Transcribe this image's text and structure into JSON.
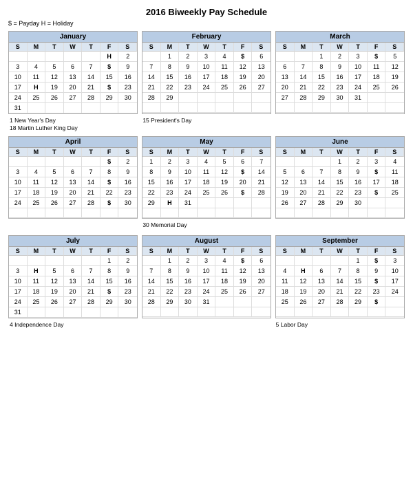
{
  "title": "2016 Biweekly Pay Schedule",
  "legend": "$ = Payday    H = Holiday",
  "months": [
    {
      "name": "January",
      "days": [
        "S",
        "M",
        "T",
        "W",
        "T",
        "F",
        "S"
      ],
      "cells": [
        "",
        "",
        "",
        "",
        "",
        "H",
        "2",
        "3",
        "4",
        "5",
        "6",
        "7",
        "$",
        "9",
        "10",
        "11",
        "12",
        "13",
        "14",
        "15",
        "16",
        "17",
        "H",
        "19",
        "20",
        "21",
        "$",
        "23",
        "24",
        "25",
        "26",
        "27",
        "28",
        "29",
        "30",
        "31",
        "",
        "",
        "",
        "",
        "",
        ""
      ],
      "notes": [
        "1 New Year's Day",
        "18 Martin Luther King Day"
      ]
    },
    {
      "name": "February",
      "days": [
        "S",
        "M",
        "T",
        "W",
        "T",
        "F",
        "S"
      ],
      "cells": [
        "",
        "1",
        "2",
        "3",
        "4",
        "$",
        "6",
        "7",
        "8",
        "9",
        "10",
        "11",
        "12",
        "13",
        "14",
        "15",
        "16",
        "17",
        "18",
        "19",
        "20",
        "21",
        "22",
        "23",
        "24",
        "25",
        "26",
        "27",
        "28",
        "29",
        "",
        "",
        "",
        "",
        "",
        "",
        "",
        "",
        "",
        "",
        "",
        ""
      ],
      "notes": [
        "15 President's Day"
      ]
    },
    {
      "name": "March",
      "days": [
        "S",
        "M",
        "T",
        "W",
        "T",
        "F",
        "S"
      ],
      "cells": [
        "",
        "",
        "1",
        "2",
        "3",
        "$",
        "5",
        "6",
        "7",
        "8",
        "9",
        "10",
        "11",
        "12",
        "13",
        "14",
        "15",
        "16",
        "17",
        "18",
        "19",
        "20",
        "21",
        "22",
        "23",
        "24",
        "25",
        "26",
        "27",
        "28",
        "29",
        "30",
        "31",
        "",
        "",
        "",
        "",
        "",
        "",
        "",
        "",
        ""
      ],
      "notes": []
    },
    {
      "name": "April",
      "days": [
        "S",
        "M",
        "T",
        "W",
        "T",
        "F",
        "S"
      ],
      "cells": [
        "",
        "",
        "",
        "",
        "",
        "$",
        "2",
        "3",
        "4",
        "5",
        "6",
        "7",
        "8",
        "9",
        "10",
        "11",
        "12",
        "13",
        "14",
        "$",
        "16",
        "17",
        "18",
        "19",
        "20",
        "21",
        "22",
        "23",
        "24",
        "25",
        "26",
        "27",
        "28",
        "$",
        "30",
        "",
        "",
        "",
        "",
        "",
        "",
        ""
      ],
      "notes": []
    },
    {
      "name": "May",
      "days": [
        "S",
        "M",
        "T",
        "W",
        "T",
        "F",
        "S"
      ],
      "cells": [
        "1",
        "2",
        "3",
        "4",
        "5",
        "6",
        "7",
        "8",
        "9",
        "10",
        "11",
        "12",
        "$",
        "14",
        "15",
        "16",
        "17",
        "18",
        "19",
        "20",
        "21",
        "22",
        "23",
        "24",
        "25",
        "26",
        "$",
        "28",
        "29",
        "H",
        "31",
        "",
        "",
        "",
        "",
        "",
        "",
        "",
        "",
        "",
        "",
        ""
      ],
      "notes": [
        "30 Memorial Day"
      ]
    },
    {
      "name": "June",
      "days": [
        "S",
        "M",
        "T",
        "W",
        "T",
        "F",
        "S"
      ],
      "cells": [
        "",
        "",
        "",
        "1",
        "2",
        "3",
        "4",
        "5",
        "6",
        "7",
        "8",
        "9",
        "$",
        "11",
        "12",
        "13",
        "14",
        "15",
        "16",
        "17",
        "18",
        "19",
        "20",
        "21",
        "22",
        "23",
        "$",
        "25",
        "26",
        "27",
        "28",
        "29",
        "30",
        "",
        "",
        "",
        "",
        "",
        "",
        "",
        "",
        ""
      ],
      "notes": []
    },
    {
      "name": "July",
      "days": [
        "S",
        "M",
        "T",
        "W",
        "T",
        "F",
        "S"
      ],
      "cells": [
        "",
        "",
        "",
        "",
        "",
        "1",
        "2",
        "3",
        "H",
        "5",
        "6",
        "7",
        "8",
        "9",
        "10",
        "11",
        "12",
        "13",
        "14",
        "15",
        "16",
        "17",
        "18",
        "19",
        "20",
        "21",
        "$",
        "23",
        "24",
        "25",
        "26",
        "27",
        "28",
        "29",
        "30",
        "31",
        "",
        "",
        "",
        "",
        "",
        ""
      ],
      "notes": [
        "4 Independence Day"
      ]
    },
    {
      "name": "August",
      "days": [
        "S",
        "M",
        "T",
        "W",
        "T",
        "F",
        "S"
      ],
      "cells": [
        "",
        "1",
        "2",
        "3",
        "4",
        "$",
        "6",
        "7",
        "8",
        "9",
        "10",
        "11",
        "12",
        "13",
        "14",
        "15",
        "16",
        "17",
        "18",
        "19",
        "20",
        "21",
        "22",
        "23",
        "24",
        "25",
        "26",
        "27",
        "28",
        "29",
        "30",
        "31",
        "",
        "",
        "",
        "",
        "",
        "",
        "",
        "",
        "",
        ""
      ],
      "notes": []
    },
    {
      "name": "September",
      "days": [
        "S",
        "M",
        "T",
        "W",
        "T",
        "F",
        "S"
      ],
      "cells": [
        "",
        "",
        "",
        "",
        "1",
        "$",
        "3",
        "4",
        "H",
        "6",
        "7",
        "8",
        "9",
        "10",
        "11",
        "12",
        "13",
        "14",
        "15",
        "$",
        "17",
        "18",
        "19",
        "20",
        "21",
        "22",
        "23",
        "24",
        "25",
        "26",
        "27",
        "28",
        "29",
        "$",
        "",
        "",
        "",
        "",
        "",
        "",
        "",
        ""
      ],
      "notes": [
        "5 Labor Day"
      ]
    }
  ]
}
